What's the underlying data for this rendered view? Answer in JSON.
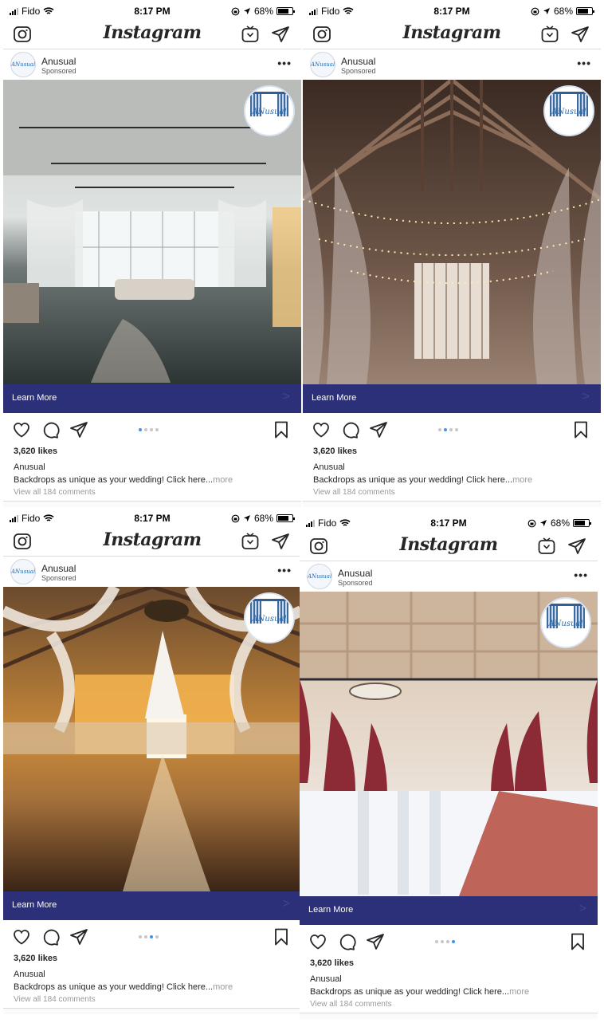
{
  "status": {
    "carrier": "Fido",
    "time": "8:17 PM",
    "battery": "68%"
  },
  "app": {
    "logo": "Instagram"
  },
  "post": {
    "username": "Anusual",
    "sponsored": "Sponsored",
    "avatar_text": "ANusual",
    "badge_text": "ANusual",
    "cta_label": "Learn More",
    "likes": "3,620 likes",
    "caption_user": "Anusual",
    "caption": "Backdrops as unique as your wedding! Click here...",
    "caption_more": "more",
    "comments": "View all 184 comments"
  },
  "panels": [
    {
      "photo": "loft with draped windows, sofa and petal aisle",
      "carousel_index": 1,
      "carousel_count": 4
    },
    {
      "photo": "barn ceiling with string lights and sheer drapes",
      "carousel_index": 2,
      "carousel_count": 4
    },
    {
      "photo": "barn hall with chandelier, hanging gown and fairy-light curtain",
      "carousel_index": 3,
      "carousel_count": 4
    },
    {
      "photo": "banquet hall with red curtains, white chairs and patterned rug",
      "carousel_index": 4,
      "carousel_count": 4
    }
  ],
  "icons": {
    "top": [
      "camera-icon",
      "igtv-icon",
      "direct-message-icon",
      "more-options-icon"
    ],
    "actions": [
      "heart-icon",
      "comment-icon",
      "share-icon",
      "bookmark-icon"
    ],
    "tabs": [
      "home-icon",
      "search-icon",
      "add-post-icon",
      "activity-heart-icon",
      "profile-icon"
    ]
  },
  "colors": {
    "cta": "#2c3079",
    "carousel_active": "#3897f0",
    "brand_blue": "#2a6db3"
  }
}
